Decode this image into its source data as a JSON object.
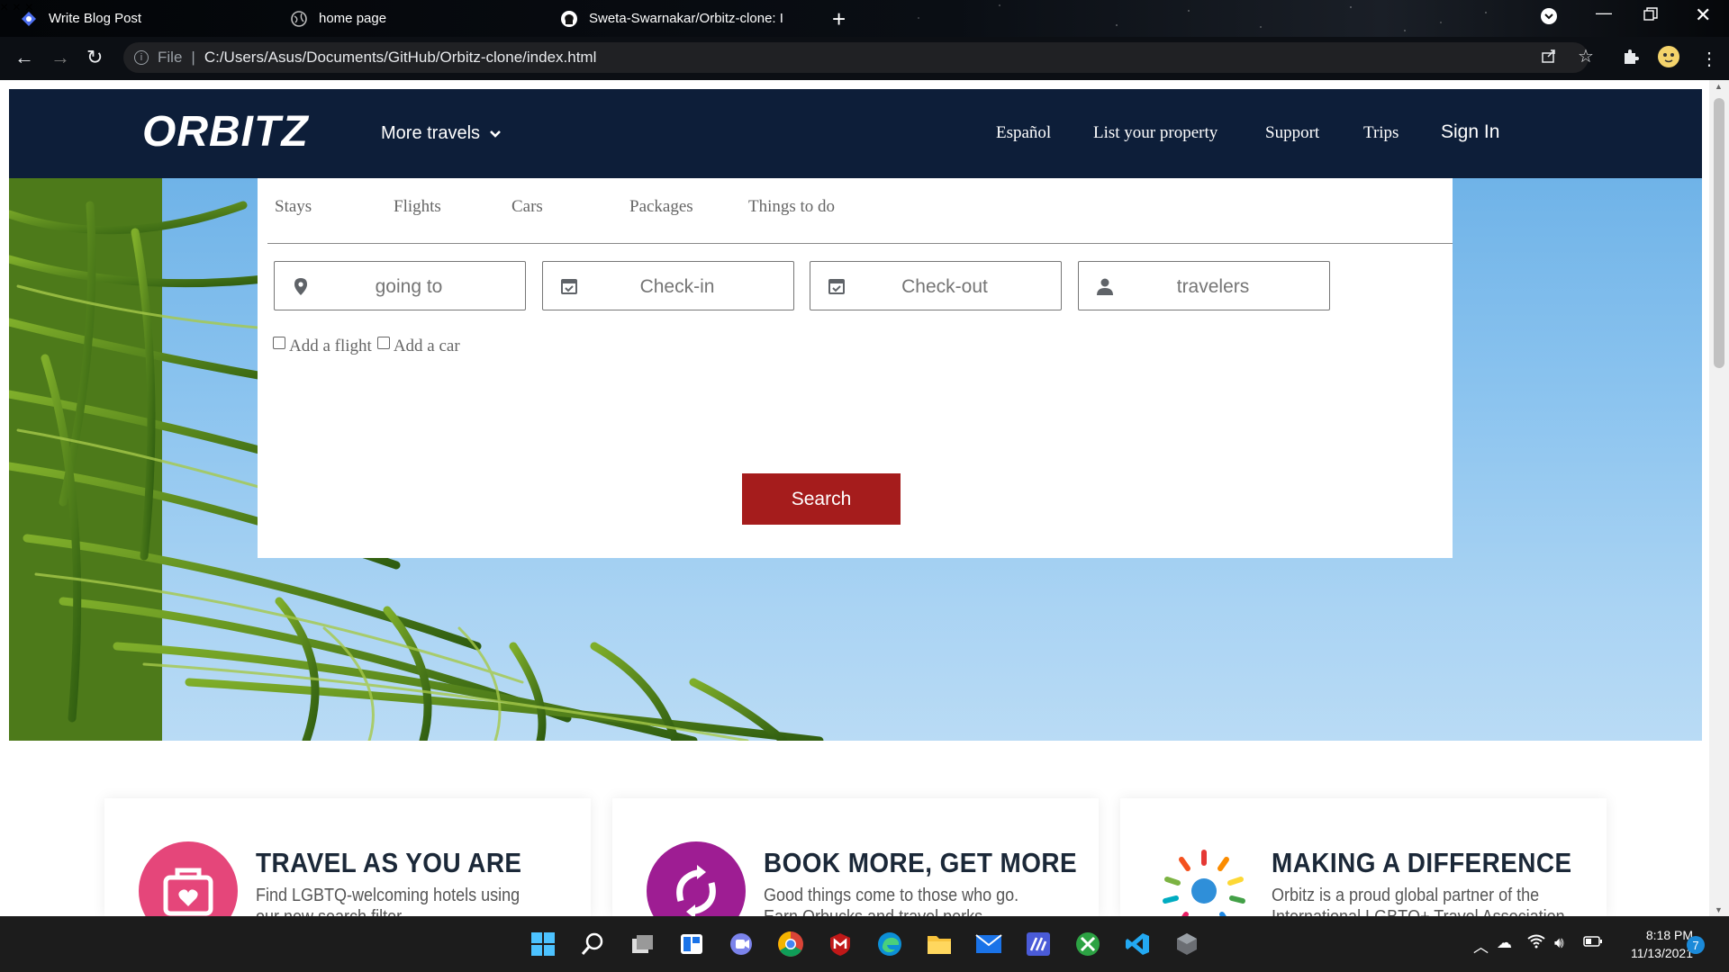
{
  "browser": {
    "tabs": [
      {
        "title": "Write Blog Post"
      },
      {
        "title": "home page"
      },
      {
        "title": "Sweta-Swarnakar/Orbitz-clone: I"
      }
    ],
    "address": {
      "scheme_label": "File",
      "url": "C:/Users/Asus/Documents/GitHub/Orbitz-clone/index.html"
    }
  },
  "site": {
    "logo_text": "ORBITZ",
    "more_travels": "More travels",
    "nav": {
      "espanol": "Español",
      "list_property": "List your property",
      "support": "Support",
      "trips": "Trips",
      "sign_in": "Sign In"
    }
  },
  "search": {
    "tabs": [
      "Stays",
      "Flights",
      "Cars",
      "Packages",
      "Things to do"
    ],
    "fields": {
      "going_to": "going to",
      "check_in": "Check-in",
      "check_out": "Check-out",
      "travelers": "travelers"
    },
    "add_flight": "Add a flight",
    "add_car": "Add a car",
    "button": "Search"
  },
  "promos": [
    {
      "title": "TRAVEL AS YOU ARE",
      "desc_line1": "Find LGBTQ-welcoming hotels using",
      "desc_line2": "our new search filter",
      "color": "#e5467a"
    },
    {
      "title": "BOOK MORE, GET MORE",
      "desc_line1": "Good things come to those who go.",
      "desc_line2": "Earn Orbucks and travel perks",
      "color": "#9e1d93"
    },
    {
      "title": "MAKING A DIFFERENCE",
      "desc_line1": "Orbitz is a proud global partner of the",
      "desc_line2": "International LGBTQ+ Travel Association",
      "color": "#ffffff"
    }
  ],
  "taskbar": {
    "time": "8:18 PM",
    "date": "11/13/2021",
    "notifications": "7"
  },
  "colors": {
    "header_bg": "#0d1e39",
    "search_button": "#a51c1c",
    "sky": "#8cc4ef"
  }
}
